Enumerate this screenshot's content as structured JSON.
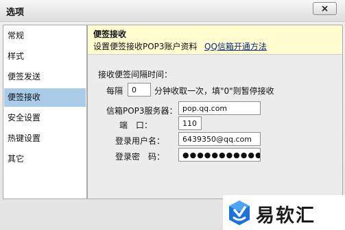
{
  "window": {
    "title": "选项"
  },
  "sidebar": {
    "items": [
      {
        "label": "常规"
      },
      {
        "label": "样式"
      },
      {
        "label": "便签发送"
      },
      {
        "label": "便签接收"
      },
      {
        "label": "安全设置"
      },
      {
        "label": "热键设置"
      },
      {
        "label": "其它"
      }
    ],
    "active_index": 3
  },
  "header": {
    "title": "便签接收",
    "description": "设置便签接收POP3账户资料",
    "link": "QQ信箱开通方法"
  },
  "form": {
    "interval_heading": "接收便签间隔时间：",
    "every_label": "每隔",
    "interval_value": "0",
    "interval_note": "分钟收取一次，填\"0\"则暂停接收",
    "server_label": "信箱POP3服务器：",
    "server_value": "pop.qq.com",
    "port_label": "端　口：",
    "port_value": "110",
    "username_label": "登录用户名：",
    "username_value": "6439350@qq.com",
    "password_label": "登录密　码：",
    "password_value": "●●●●●●●●●●●"
  },
  "watermark": {
    "text": "易软汇",
    "logo_icon": "yiruanhui-logo"
  },
  "colors": {
    "sidebar_active": "#a9cde8",
    "header_background": "#fffcd0",
    "link": "#0b2a7a"
  }
}
